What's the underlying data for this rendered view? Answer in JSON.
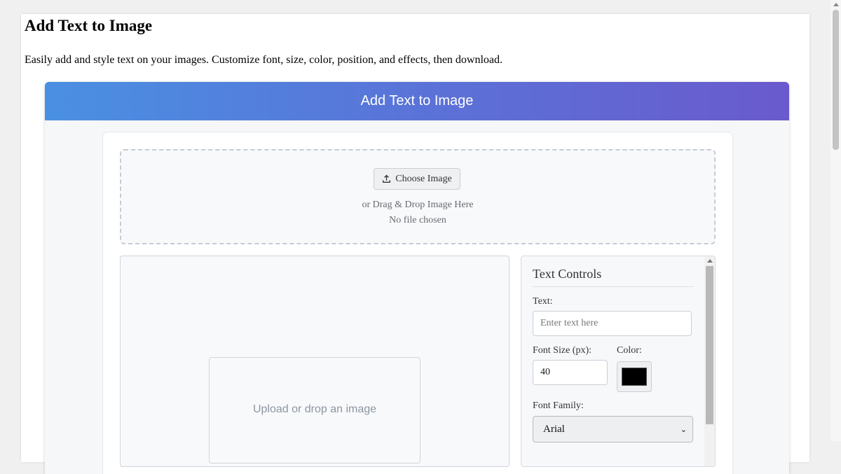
{
  "page": {
    "title": "Add Text to Image",
    "description": "Easily add and style text on your images. Customize font, size, color, position, and effects, then download."
  },
  "tool": {
    "header_title": "Add Text to Image",
    "upload": {
      "choose_label": "Choose Image",
      "drop_hint": "or Drag & Drop Image Here",
      "file_status": "No file chosen"
    },
    "preview": {
      "placeholder": "Upload or drop an image"
    },
    "controls": {
      "title": "Text Controls",
      "text_label": "Text:",
      "text_placeholder": "Enter text here",
      "font_size_label": "Font Size (px):",
      "font_size_value": "40",
      "color_label": "Color:",
      "color_value": "#000000",
      "font_family_label": "Font Family:",
      "font_family_value": "Arial"
    }
  },
  "icons": {
    "upload": "upload-icon",
    "select_chevron": "chevron-down-icon"
  }
}
